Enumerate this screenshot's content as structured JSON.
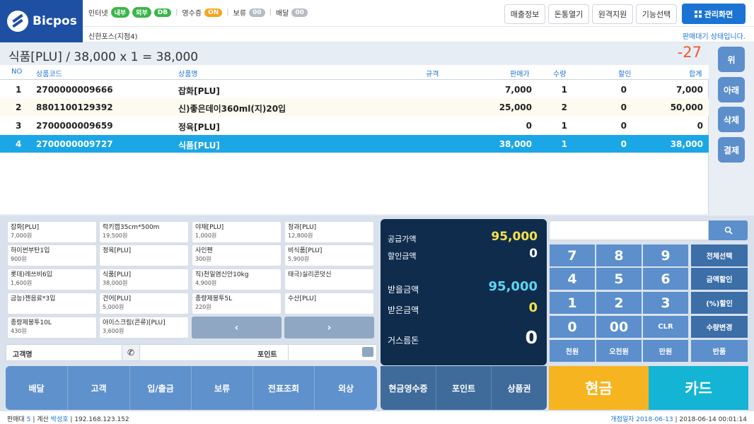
{
  "logo": {
    "text": "Bicpos"
  },
  "status": {
    "internet_label": "인터넷",
    "internal": "내부",
    "external": "외부",
    "db": "DB",
    "receipt_label": "영수증",
    "receipt_state": "ON",
    "hold_label": "보류",
    "hold_count": "00",
    "delivery_label": "배달",
    "delivery_count": "00"
  },
  "top_buttons": {
    "sales_info": "매출정보",
    "cash_drawer": "돈통열기",
    "remote_support": "원격지원",
    "function_select": "기능선택",
    "admin": "관리화면"
  },
  "shop_name": "신한포스(지점4)",
  "ready_status": "판매대기 상태입니다.",
  "calc": {
    "text": "식품[PLU] / 38,000 x 1 = 38,000",
    "display": "-27"
  },
  "table": {
    "headers": {
      "no": "NO",
      "code": "상품코드",
      "name": "상품명",
      "spec": "규격",
      "price": "판매가",
      "qty": "수량",
      "discount": "할인",
      "total": "합계"
    },
    "rows": [
      {
        "no": "1",
        "code": "2700000009666",
        "name": "잡화[PLU]",
        "price": "7,000",
        "qty": "1",
        "discount": "0",
        "total": "7,000"
      },
      {
        "no": "2",
        "code": "8801100129392",
        "name": "신)좋은데이360ml(지)20입",
        "price": "25,000",
        "qty": "2",
        "discount": "0",
        "total": "50,000"
      },
      {
        "no": "3",
        "code": "2700000009659",
        "name": "정육[PLU]",
        "price": "0",
        "qty": "1",
        "discount": "0",
        "total": "0"
      },
      {
        "no": "4",
        "code": "2700000009727",
        "name": "식품[PLU]",
        "price": "38,000",
        "qty": "1",
        "discount": "0",
        "total": "38,000"
      }
    ]
  },
  "side_buttons": {
    "up": "위",
    "down": "아래",
    "delete": "삭제",
    "pay": "결제"
  },
  "products": [
    {
      "name": "잡화[PLU]",
      "price": "7,000원"
    },
    {
      "name": "럭키캡35cm*500m",
      "price": "19,500원"
    },
    {
      "name": "야채[PLU]",
      "price": "1,000원"
    },
    {
      "name": "청과[PLU]",
      "price": "12,800원"
    },
    {
      "name": "하이썬부탄1입",
      "price": "900원"
    },
    {
      "name": "정육[PLU]",
      "price": ""
    },
    {
      "name": "사인펜",
      "price": "300원"
    },
    {
      "name": "비식품[PLU]",
      "price": "5,900원"
    },
    {
      "name": "롯데)레쓰비6입",
      "price": "1,600원"
    },
    {
      "name": "식품[PLU]",
      "price": "38,000원"
    },
    {
      "name": "직)천일염신안10kg",
      "price": "4,900원"
    },
    {
      "name": "태극)실리콘덧신",
      "price": ""
    },
    {
      "name": "금능)젠음료*3입",
      "price": ""
    },
    {
      "name": "건어[PLU]",
      "price": "5,000원"
    },
    {
      "name": "종량제봉투5L",
      "price": "220원"
    },
    {
      "name": "수산[PLU]",
      "price": ""
    },
    {
      "name": "종량제봉투10L",
      "price": "430원"
    },
    {
      "name": "아이스크림(콘류)[PLU]",
      "price": "3,600원"
    }
  ],
  "product_nav": {
    "prev": "‹",
    "next": "›"
  },
  "customer": {
    "label": "고객명",
    "point_label": "포인트"
  },
  "functions": [
    "배달",
    "고객",
    "입/출금",
    "보류",
    "전표조회",
    "외상"
  ],
  "payment": {
    "supply_label": "공급가액",
    "supply_value": "95,000",
    "discount_label": "할인금액",
    "discount_value": "0",
    "receivable_label": "받을금액",
    "receivable_value": "95,000",
    "received_label": "받은금액",
    "received_value": "0",
    "change_label": "거스름돈",
    "change_value": "0",
    "colors": {
      "yellow": "#f7e14a",
      "cyan": "#5fd6f0",
      "white": "#ffffff"
    }
  },
  "pay_buttons": [
    "현금영수증",
    "포인트",
    "상품권"
  ],
  "keypad": {
    "rows": [
      [
        "7",
        "8",
        "9",
        "전체선택"
      ],
      [
        "4",
        "5",
        "6",
        "금액할인"
      ],
      [
        "1",
        "2",
        "3",
        "(%)할인"
      ],
      [
        "0",
        "00",
        "CLR",
        "수량변경"
      ],
      [
        "천원",
        "오천원",
        "만원",
        "반품"
      ]
    ]
  },
  "cash": "현금",
  "card": "카드",
  "footer": {
    "register_label": "판매대",
    "register_no": "5",
    "cashier_label": "계산",
    "cashier": "박성호",
    "ip": "192.168.123.152",
    "open_date_label": "개점일자",
    "open_date": "2018-06-13",
    "datetime": "2018-06-14 00:01:14"
  }
}
